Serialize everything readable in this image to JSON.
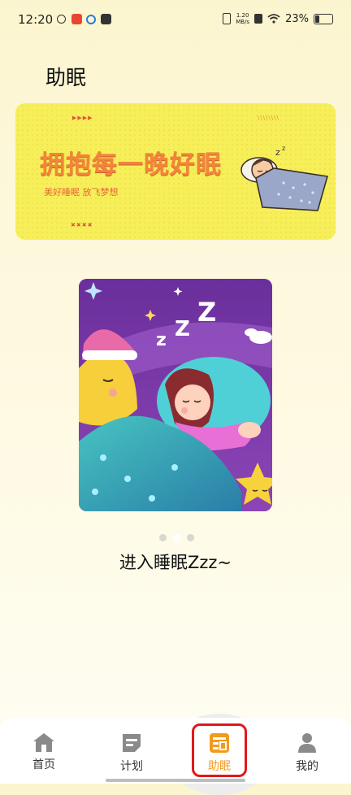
{
  "status_bar": {
    "time": "12:20",
    "net_speed_value": "1.20",
    "net_speed_unit": "MB/s",
    "battery": "23%"
  },
  "page": {
    "title": "助眠"
  },
  "banner": {
    "title": "拥抱每一晚好眠",
    "subtitle": "美好睡眠 放飞梦想",
    "background_color": "#f7ef5a",
    "title_color": "#f3843a"
  },
  "carousel": {
    "slide_count": 3,
    "active_index": 1,
    "caption": "进入睡眠Zzz~"
  },
  "tab_bar": {
    "active_color": "#f39a1e",
    "tabs": [
      {
        "label": "首页",
        "icon": "home-icon"
      },
      {
        "label": "计划",
        "icon": "plan-icon"
      },
      {
        "label": "助眠",
        "icon": "sleep-aid-icon"
      },
      {
        "label": "我的",
        "icon": "person-icon"
      }
    ]
  }
}
